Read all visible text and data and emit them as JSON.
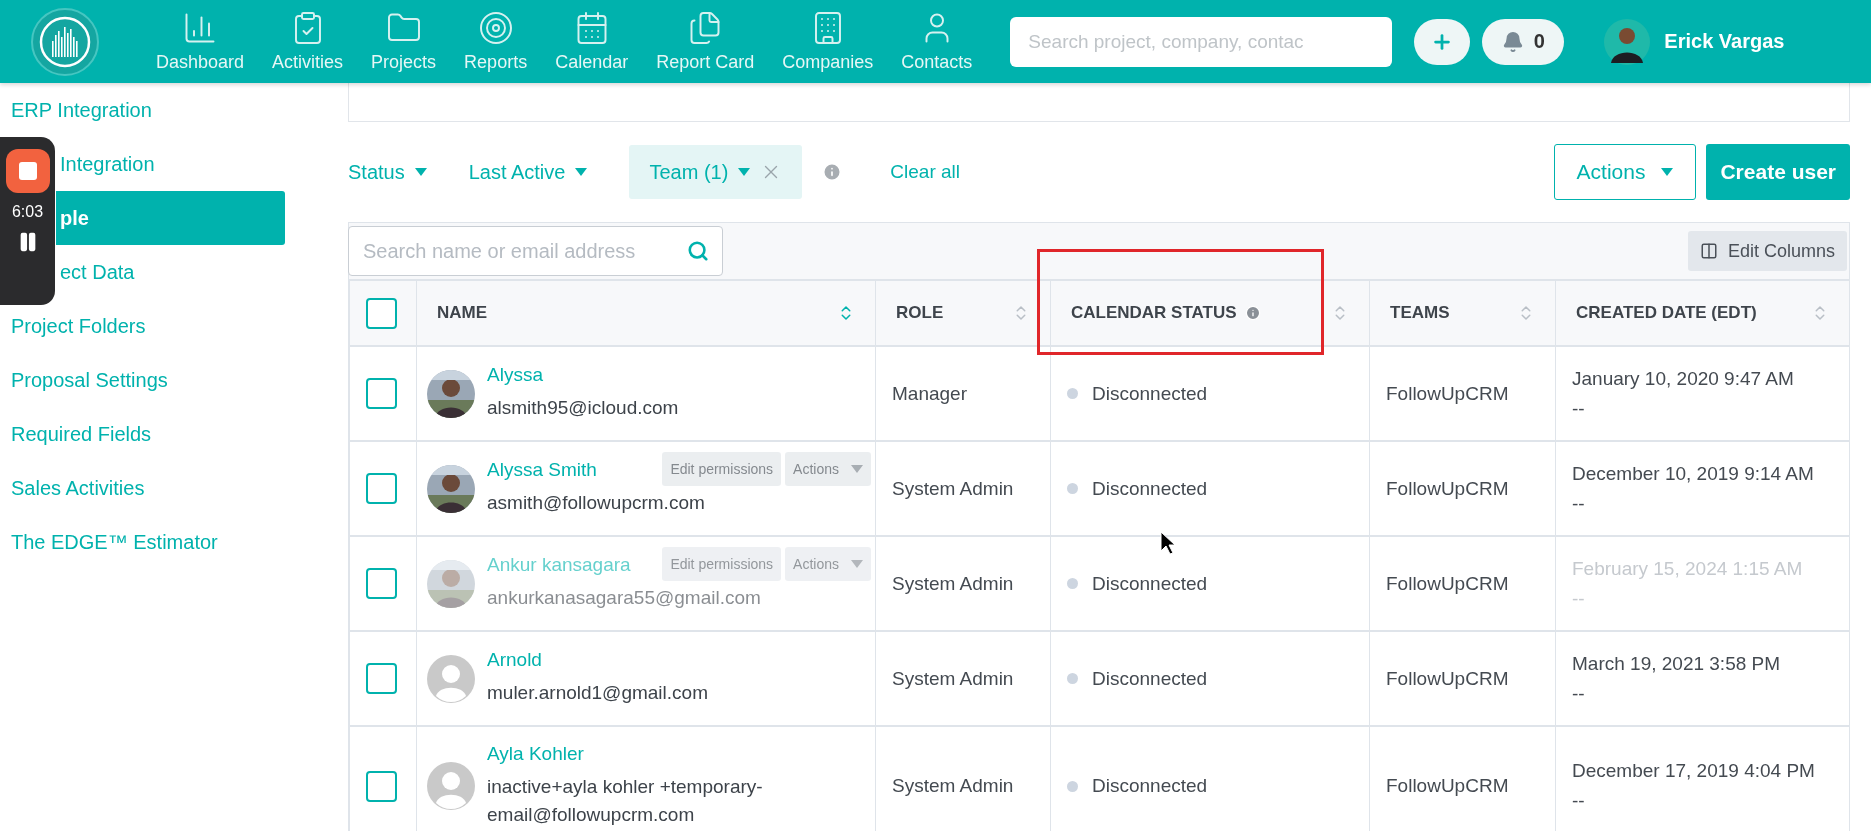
{
  "topbar": {
    "nav": [
      {
        "label": "Dashboard"
      },
      {
        "label": "Activities"
      },
      {
        "label": "Projects"
      },
      {
        "label": "Reports"
      },
      {
        "label": "Calendar"
      },
      {
        "label": "Report Card"
      },
      {
        "label": "Companies"
      },
      {
        "label": "Contacts"
      }
    ],
    "search": {
      "placeholder": "Search project, company, contac"
    },
    "notifications": "0",
    "user": "Erick Vargas"
  },
  "sidebar": {
    "items": [
      {
        "label": "ERP Integration",
        "selected": false,
        "partial": false
      },
      {
        "label": "Integration",
        "selected": false,
        "partial": true
      },
      {
        "label": "ple",
        "selected": true,
        "partial": true
      },
      {
        "label": "ect Data",
        "selected": false,
        "partial": true
      },
      {
        "label": "Project Folders",
        "selected": false,
        "partial": false
      },
      {
        "label": "Proposal Settings",
        "selected": false,
        "partial": false
      },
      {
        "label": "Required Fields",
        "selected": false,
        "partial": false
      },
      {
        "label": "Sales Activities",
        "selected": false,
        "partial": false
      },
      {
        "label": "The EDGE™ Estimator",
        "selected": false,
        "partial": false
      }
    ]
  },
  "recorder": {
    "time": "6:03"
  },
  "filters": [
    {
      "label": "Status",
      "active": false
    },
    {
      "label": "Last Active",
      "active": false
    },
    {
      "label": "Team (1)",
      "active": true
    }
  ],
  "clear": "Clear all",
  "actions": "Actions",
  "create": "Create user",
  "table": {
    "search": {
      "placeholder": "Search name or email address"
    },
    "edit_columns": "Edit Columns",
    "select_all": {
      "checked": false
    },
    "columns": [
      {
        "label": "NAME",
        "sorted": true,
        "info": false
      },
      {
        "label": "ROLE",
        "sorted": false,
        "info": false
      },
      {
        "label": "CALENDAR STATUS",
        "sorted": false,
        "info": true
      },
      {
        "label": "TEAMS",
        "sorted": false,
        "info": false
      },
      {
        "label": "CREATED DATE (EDT)",
        "sorted": false,
        "info": false
      }
    ],
    "rows": [
      {
        "checked": false,
        "inactive": false,
        "name": "Alyssa",
        "email": "alsmith95@icloud.com",
        "role": "Manager",
        "status": "Disconnected",
        "team": "FollowUpCRM",
        "created": "January 10, 2020 9:47 AM",
        "created_sub": "--"
      },
      {
        "checked": false,
        "inactive": false,
        "name": "Alyssa Smith",
        "email": "asmith@followupcrm.com",
        "role": "System Admin",
        "status": "Disconnected",
        "team": "FollowUpCRM",
        "created": "December 10, 2019 9:14 AM",
        "created_sub": "--",
        "row_actions": {
          "edit": "Edit permissions",
          "menu": "Actions"
        }
      },
      {
        "checked": false,
        "inactive": true,
        "name": "Ankur kansagara",
        "email": "ankurkanasagara55@gmail.com",
        "role": "System Admin",
        "status": "Disconnected",
        "team": "FollowUpCRM",
        "created": "February 15, 2024 1:15 AM",
        "created_sub": "--",
        "row_actions": {
          "edit": "Edit permissions",
          "menu": "Actions"
        }
      },
      {
        "checked": false,
        "inactive": false,
        "avatar": {
          "kind": "default"
        },
        "name": "Arnold",
        "email": "muler.arnold1@gmail.com",
        "role": "System Admin",
        "status": "Disconnected",
        "team": "FollowUpCRM",
        "created": "March 19, 2021 3:58 PM",
        "created_sub": "--"
      },
      {
        "checked": false,
        "inactive": false,
        "avatar": {
          "kind": "default"
        },
        "name": "Ayla Kohler",
        "email": "inactive+ayla kohler +temporary-email@followupcrm.com",
        "role": "System Admin",
        "status": "Disconnected",
        "team": "FollowUpCRM",
        "created": "December 17, 2019 4:04 PM",
        "created_sub": "--"
      }
    ]
  }
}
